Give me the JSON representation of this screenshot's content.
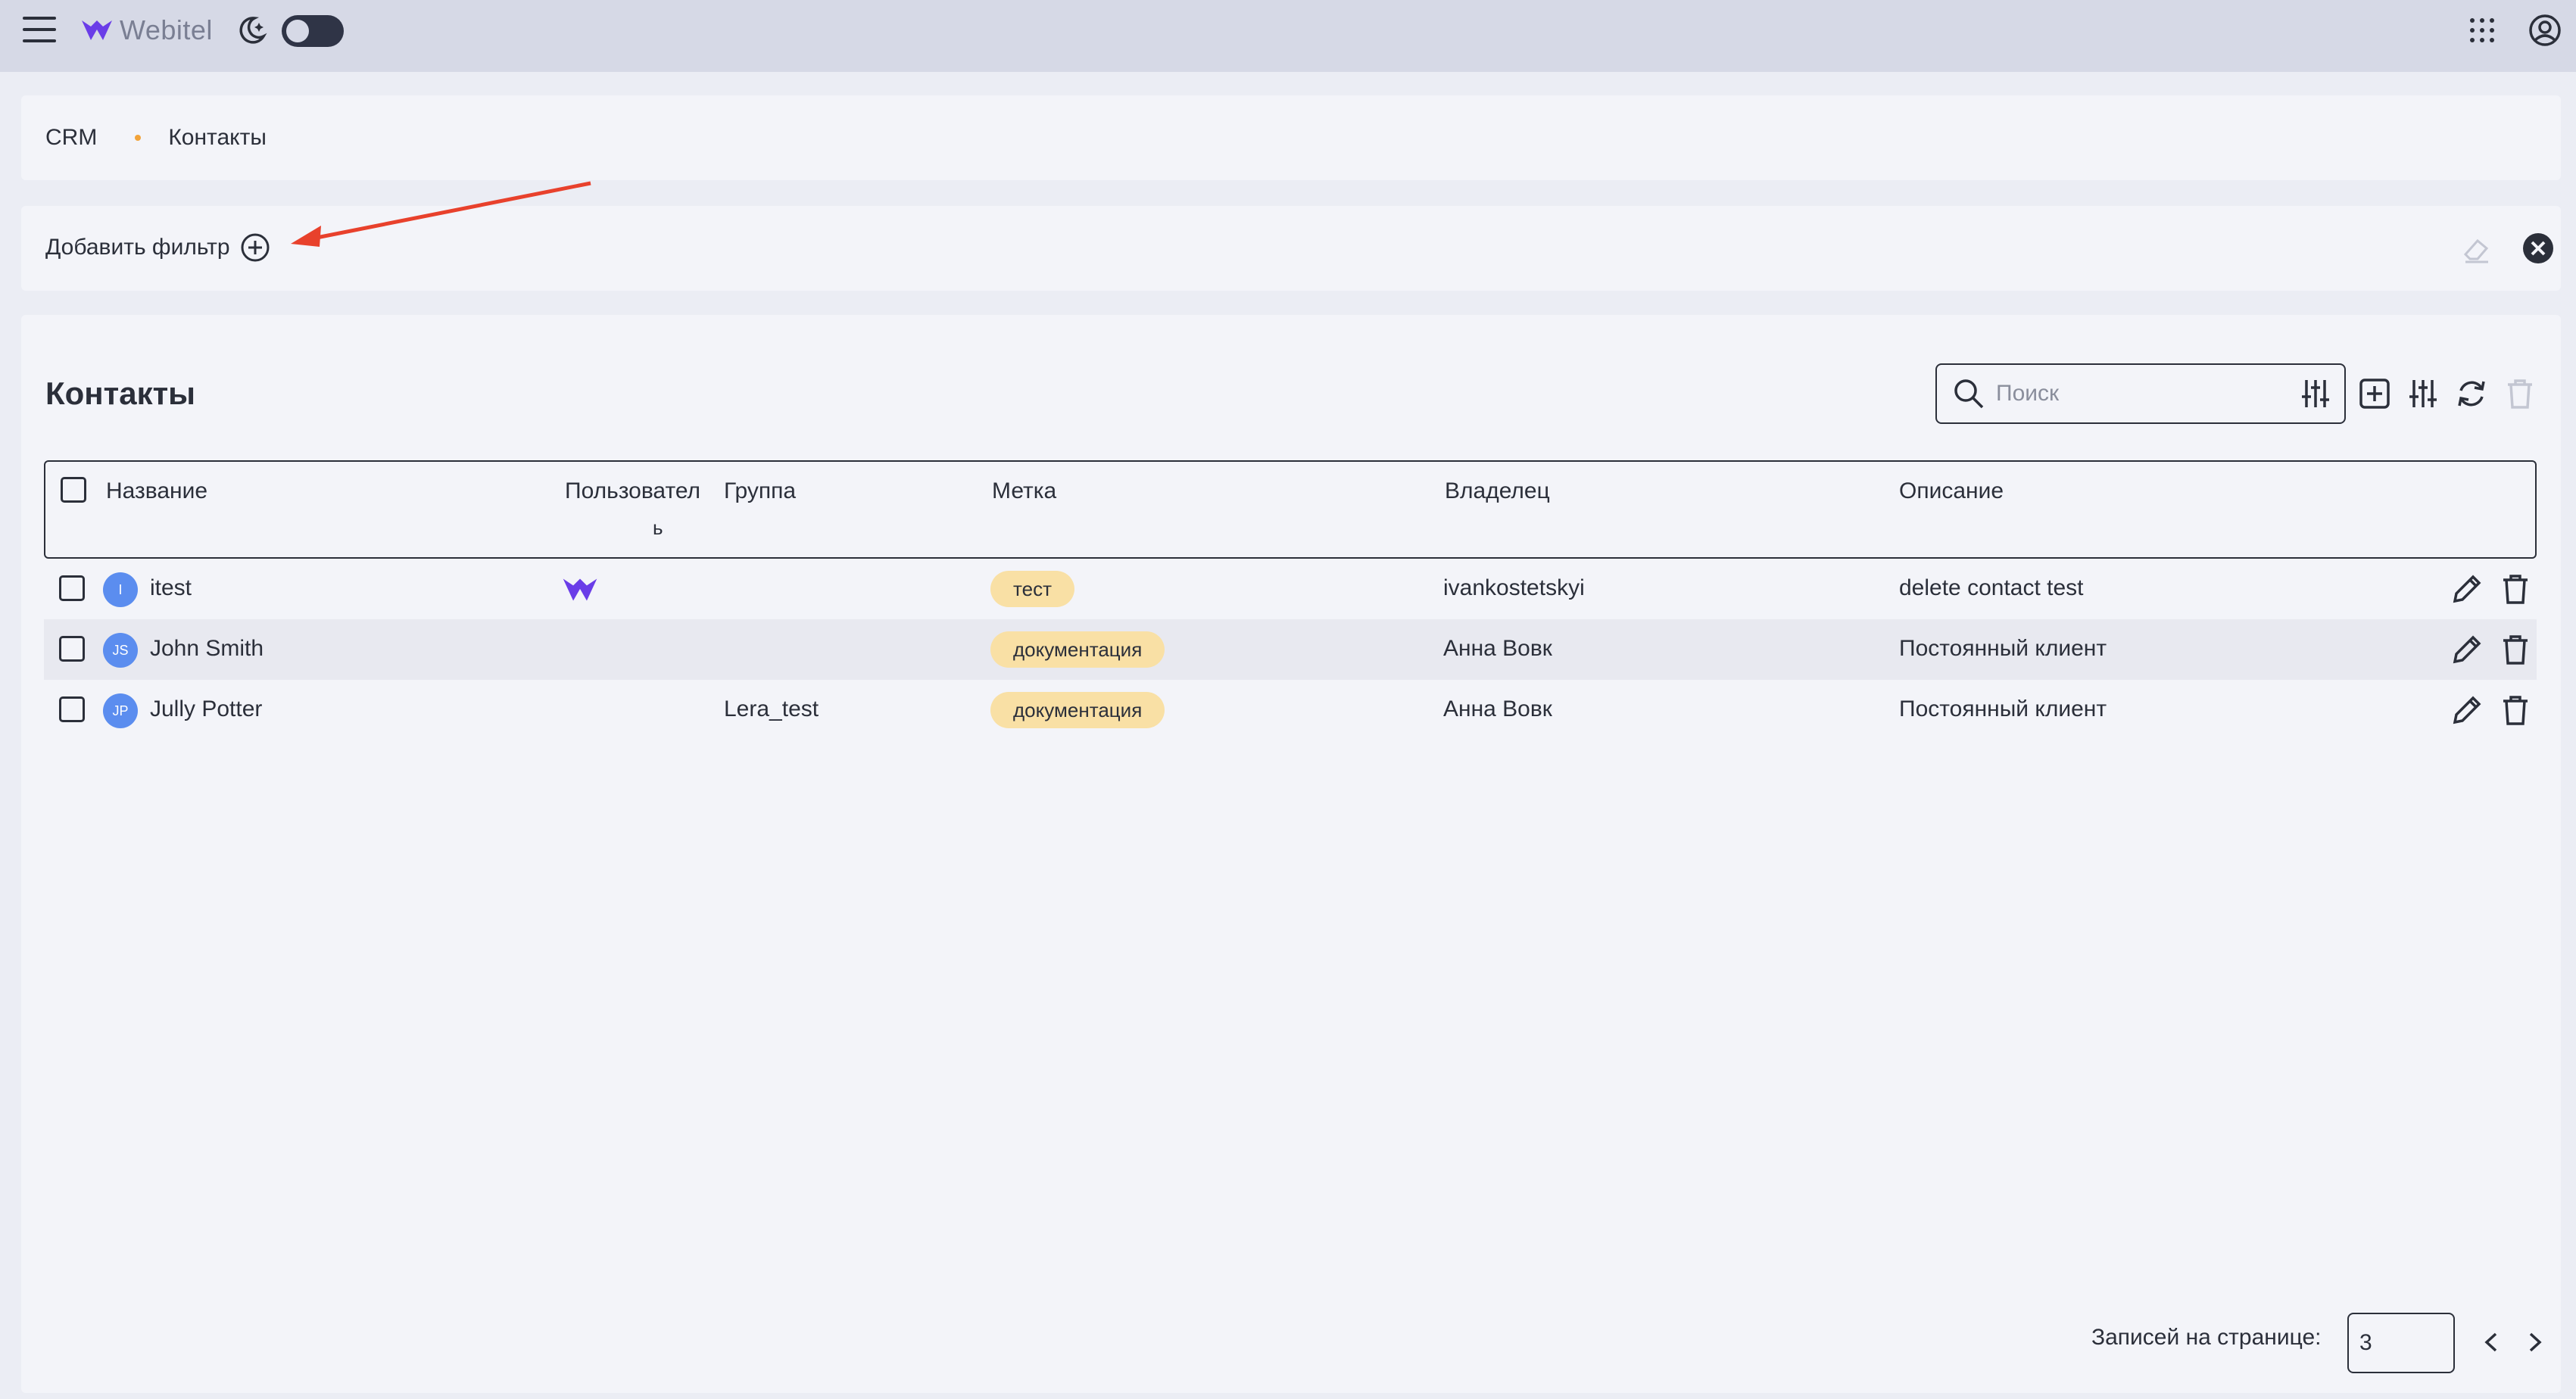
{
  "header": {
    "brand": "Webitel",
    "icons": [
      "menu-icon",
      "webitel-logo-icon",
      "moon-icon",
      "theme-toggle",
      "apps-grid-icon",
      "user-account-icon"
    ]
  },
  "breadcrumb": {
    "root": "CRM",
    "current": "Контакты"
  },
  "filters": {
    "add_label": "Добавить фильтр"
  },
  "main": {
    "title": "Контакты",
    "search_placeholder": "Поиск"
  },
  "table": {
    "columns": {
      "name": "Название",
      "user": "Пользовател",
      "user_wrap": "ь",
      "group": "Группа",
      "label": "Метка",
      "owner": "Владелец",
      "description": "Описание"
    },
    "rows": [
      {
        "initials": "I",
        "name": "itest",
        "user_icon": "webitel-logo-icon",
        "group": "",
        "tag": "тест",
        "owner": "ivankostetskyi",
        "description": "delete contact test"
      },
      {
        "initials": "JS",
        "name": "John Smith",
        "group": "",
        "tag": "документация",
        "owner": "Анна Вовк",
        "description": "Постоянный клиент"
      },
      {
        "initials": "JP",
        "name": "Jully Potter",
        "group": "Lera_test",
        "tag": "документация",
        "owner": "Анна Вовк",
        "description": "Постоянный клиент"
      }
    ]
  },
  "pagination": {
    "label": "Записей на странице:",
    "per_page": "3"
  },
  "colors": {
    "header_bg": "#d6d9e6",
    "panel_bg": "#f3f4f9",
    "tag_bg": "#f9e0a5",
    "avatar_bg": "#5b8def",
    "accent_dot": "#f2a33a",
    "annotation_arrow": "#e8412c",
    "brand_purple": "#6a3de8"
  }
}
